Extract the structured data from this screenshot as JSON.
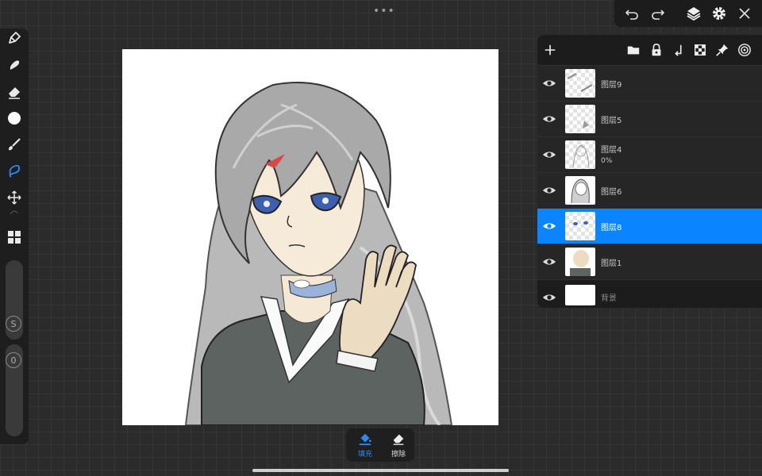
{
  "app": {
    "more_menu_icon": "ellipsis-icon"
  },
  "toolbar": {
    "tools": [
      {
        "name": "pen-tool",
        "icon": "pen-icon"
      },
      {
        "name": "smudge-tool",
        "icon": "smudge-icon"
      },
      {
        "name": "eraser-tool",
        "icon": "eraser-icon"
      },
      {
        "name": "color-picker",
        "icon": "color-circle-icon"
      },
      {
        "name": "brush-tool",
        "icon": "brush-icon"
      },
      {
        "name": "lasso-tool",
        "icon": "lasso-icon",
        "active": true
      },
      {
        "name": "transform-tool",
        "icon": "move-icon"
      },
      {
        "name": "layout-tool",
        "icon": "grid-icon"
      }
    ],
    "size_slider_label": "S",
    "opacity_slider_label": "0"
  },
  "topbar": {
    "undo_icon": "undo-icon",
    "redo_icon": "redo-icon",
    "layers_icon": "layers-icon",
    "settings_icon": "gear-icon",
    "close_icon": "close-icon"
  },
  "layers_panel": {
    "header_icons": [
      "plus-icon",
      "folder-icon",
      "lock-icon",
      "merge-down-icon",
      "checker-icon",
      "pin-icon",
      "target-icon"
    ],
    "layers": [
      {
        "name": "图层9",
        "opacity": "",
        "visible": true,
        "selected": false
      },
      {
        "name": "图层5",
        "opacity": "",
        "visible": true,
        "selected": false
      },
      {
        "name": "图层4",
        "opacity": "0%",
        "visible": true,
        "selected": false
      },
      {
        "name": "图层6",
        "opacity": "",
        "visible": true,
        "selected": false
      },
      {
        "name": "图层8",
        "opacity": "",
        "visible": true,
        "selected": true
      },
      {
        "name": "图层1",
        "opacity": "",
        "visible": true,
        "selected": false
      },
      {
        "name": "背景",
        "opacity": "",
        "visible": true,
        "selected": false,
        "background": true
      }
    ]
  },
  "fill_bar": {
    "fill_label": "填充",
    "erase_label": "擦除",
    "active_color": "#2a8bf2"
  },
  "colors": {
    "accent": "#0a84ff",
    "panel": "#1c1c1c",
    "background": "#2b2b2b"
  }
}
